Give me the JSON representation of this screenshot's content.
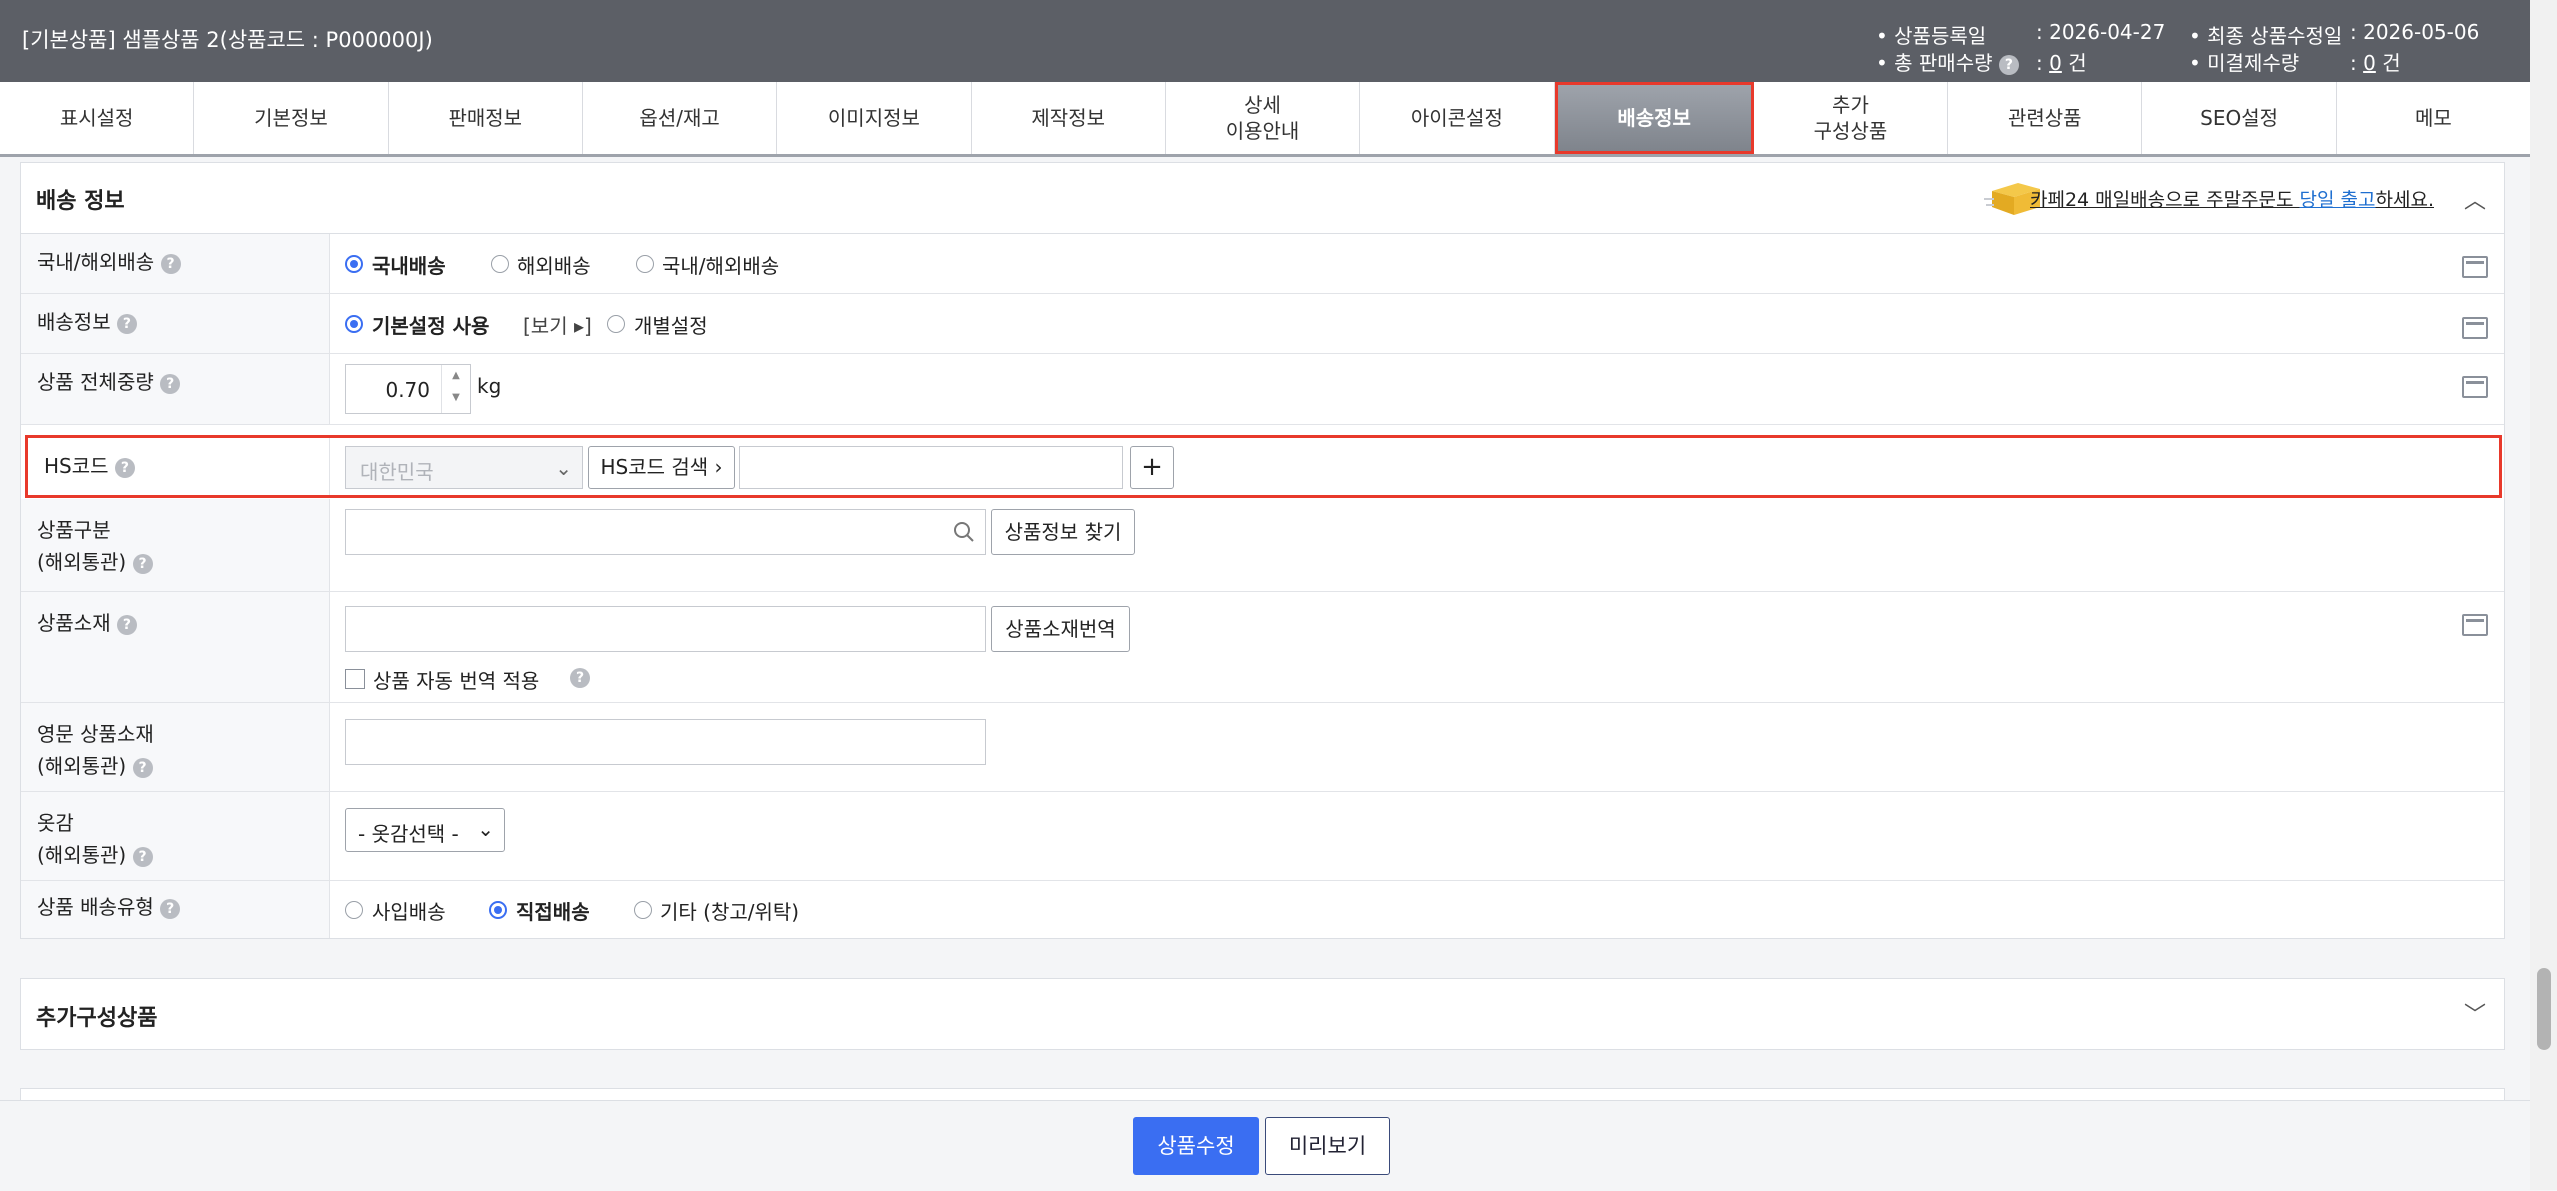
{
  "header": {
    "title": "[기본상품] 샘플상품 2(상품코드 : P000000J)",
    "reg_date_label": "• 상품등록일",
    "reg_date_value": ": 2026-04-27",
    "mod_date_label": "• 최종 상품수정일",
    "mod_date_value": ": 2026-05-06",
    "total_sales_label": "• 총 판매수량",
    "total_sales_value": "0",
    "unpaid_label": "• 미결제수량",
    "unpaid_value": "0",
    "unit": "건",
    "colon": ":"
  },
  "tabs": [
    {
      "label": "표시설정"
    },
    {
      "label": "기본정보"
    },
    {
      "label": "판매정보"
    },
    {
      "label": "옵션/재고"
    },
    {
      "label": "이미지정보"
    },
    {
      "label": "제작정보"
    },
    {
      "label": "상세\n이용안내"
    },
    {
      "label": "아이콘설정"
    },
    {
      "label": "배송정보",
      "active": true
    },
    {
      "label": "추가\n구성상품"
    },
    {
      "label": "관련상품"
    },
    {
      "label": "SEO설정"
    },
    {
      "label": "메모"
    }
  ],
  "shipping": {
    "section_title": "배송 정보",
    "promo_prefix": "카페24 매일배송으로 주말주문도 ",
    "promo_link": "당일 출고",
    "promo_suffix": "하세요.",
    "help": "?",
    "rows": {
      "domestic": {
        "label": "국내/해외배송",
        "options": [
          "국내배송",
          "해외배송",
          "국내/해외배송"
        ],
        "selected": "국내배송"
      },
      "info": {
        "label": "배송정보",
        "options": [
          "기본설정 사용",
          "개별설정"
        ],
        "view_link": "[보기 ▸]",
        "selected": "기본설정 사용"
      },
      "weight": {
        "label": "상품 전체중량",
        "value": "0.70",
        "unit": "kg"
      },
      "hscode": {
        "label": "HS코드",
        "country": "대한민국",
        "search_button": "HS코드 검색 ›",
        "code_value": "",
        "add_button": "+"
      },
      "category": {
        "label1": "상품구분",
        "label2": "(해외통관)",
        "search_value": "",
        "find_button": "상품정보 찾기"
      },
      "material": {
        "label": "상품소재",
        "value": "",
        "translate_button": "상품소재번역",
        "auto_translate": "상품 자동 번역 적용"
      },
      "english_material": {
        "label1": "영문 상품소재",
        "label2": "(해외통관)",
        "value": ""
      },
      "fabric": {
        "label1": "옷감",
        "label2": "(해외통관)",
        "select_value": "- 옷감선택 -"
      },
      "ship_type": {
        "label": "상품 배송유형",
        "options": [
          "사입배송",
          "직접배송",
          "기타 (창고/위탁)"
        ],
        "selected": "직접배송"
      }
    }
  },
  "extra_section": {
    "title": "추가구성상품"
  },
  "footer": {
    "save_button": "상품수정",
    "preview_button": "미리보기"
  },
  "colors": {
    "header_bg": "#5c5f66",
    "accent": "#3a6ef2",
    "highlight": "#e8392b"
  }
}
